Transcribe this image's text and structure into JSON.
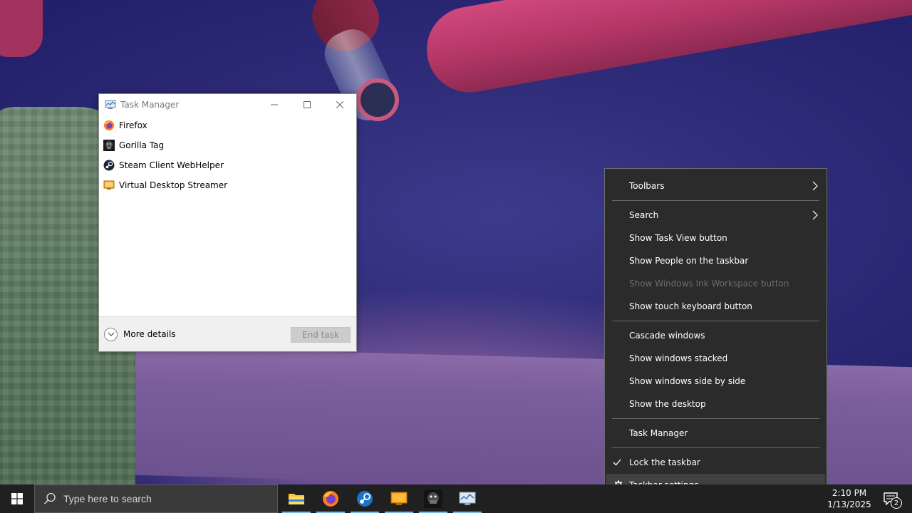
{
  "task_manager": {
    "title": "Task Manager",
    "apps": [
      {
        "label": "Firefox",
        "icon": "firefox-icon"
      },
      {
        "label": "Gorilla Tag",
        "icon": "gorilla-tag-icon"
      },
      {
        "label": "Steam Client WebHelper",
        "icon": "steam-icon"
      },
      {
        "label": "Virtual Desktop Streamer",
        "icon": "virtual-desktop-icon"
      }
    ],
    "more_details": "More details",
    "end_task": "End task"
  },
  "context_menu": {
    "items": {
      "toolbars": "Toolbars",
      "search": "Search",
      "show_task_view": "Show Task View button",
      "show_people": "Show People on the taskbar",
      "show_ink": "Show Windows Ink Workspace button",
      "show_touch_keyboard": "Show touch keyboard button",
      "cascade": "Cascade windows",
      "stacked": "Show windows stacked",
      "side_by_side": "Show windows side by side",
      "show_desktop": "Show the desktop",
      "task_manager": "Task Manager",
      "lock_taskbar": "Lock the taskbar",
      "taskbar_settings": "Taskbar settings"
    },
    "lock_taskbar_checked": true
  },
  "taskbar": {
    "search_placeholder": "Type here to search",
    "pinned": [
      "file-explorer-icon",
      "firefox-icon",
      "steam-icon",
      "virtual-desktop-icon",
      "gorilla-tag-icon",
      "task-manager-icon"
    ],
    "clock_time": "2:10 PM",
    "clock_date": "1/13/2025",
    "notification_count": "2"
  }
}
